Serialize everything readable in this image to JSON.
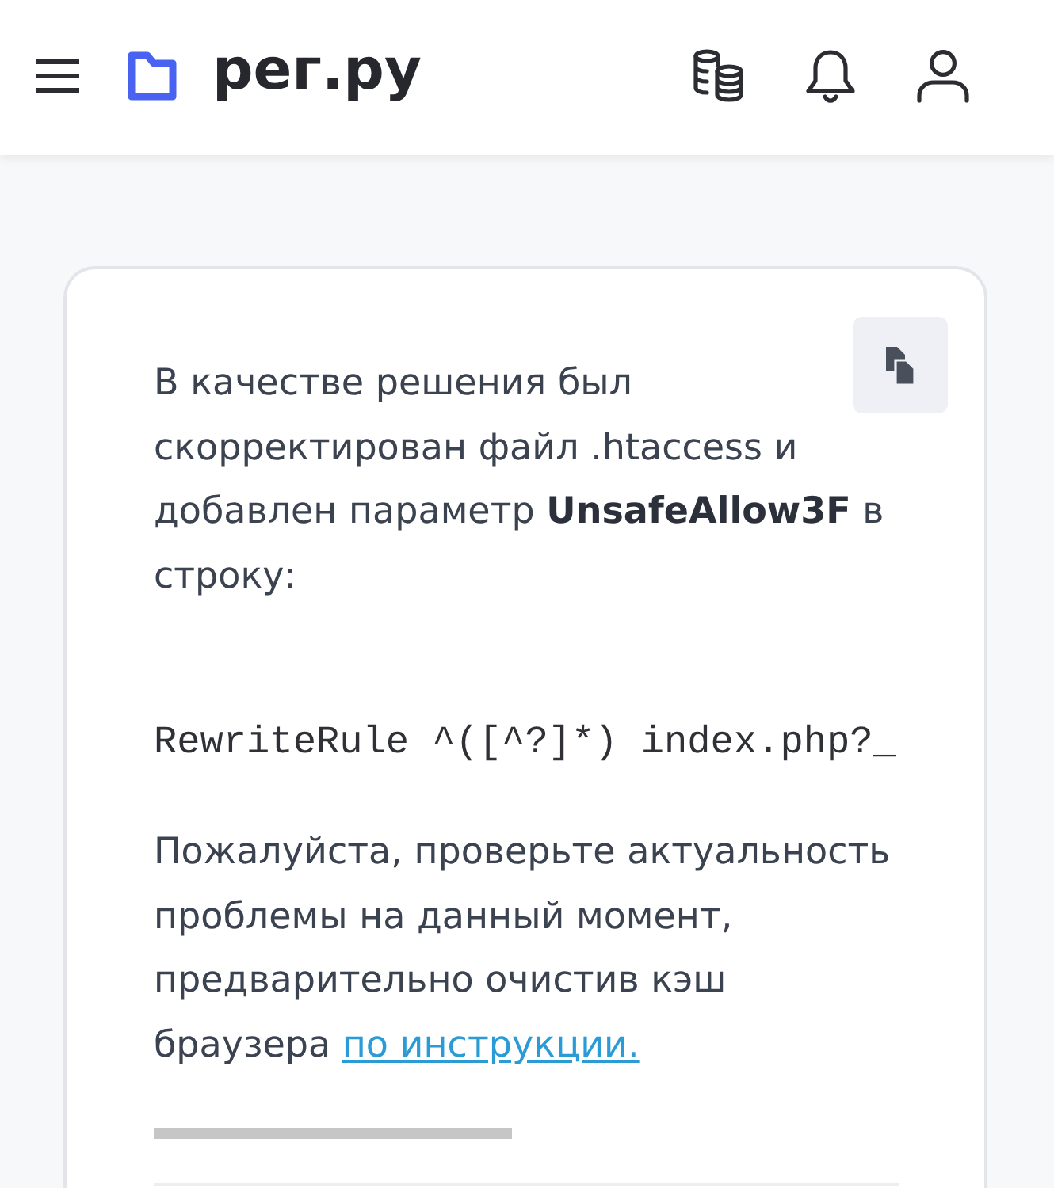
{
  "header": {
    "logo_text": "рег.ру"
  },
  "card": {
    "blocks": [
      {
        "kind": "text",
        "text": "В качестве решения был скорректирован файл .htaccess и добавлен параметр **UnsafeAllow3F** в строку:"
      },
      {
        "kind": "code",
        "text": "RewriteRule ^([^?]*) index.php?_"
      },
      {
        "kind": "text",
        "text": "Пожалуйста, проверьте актуальность проблемы на данный момент, предварительно очистив кэш браузера",
        "link": "по инструкции."
      }
    ]
  }
}
